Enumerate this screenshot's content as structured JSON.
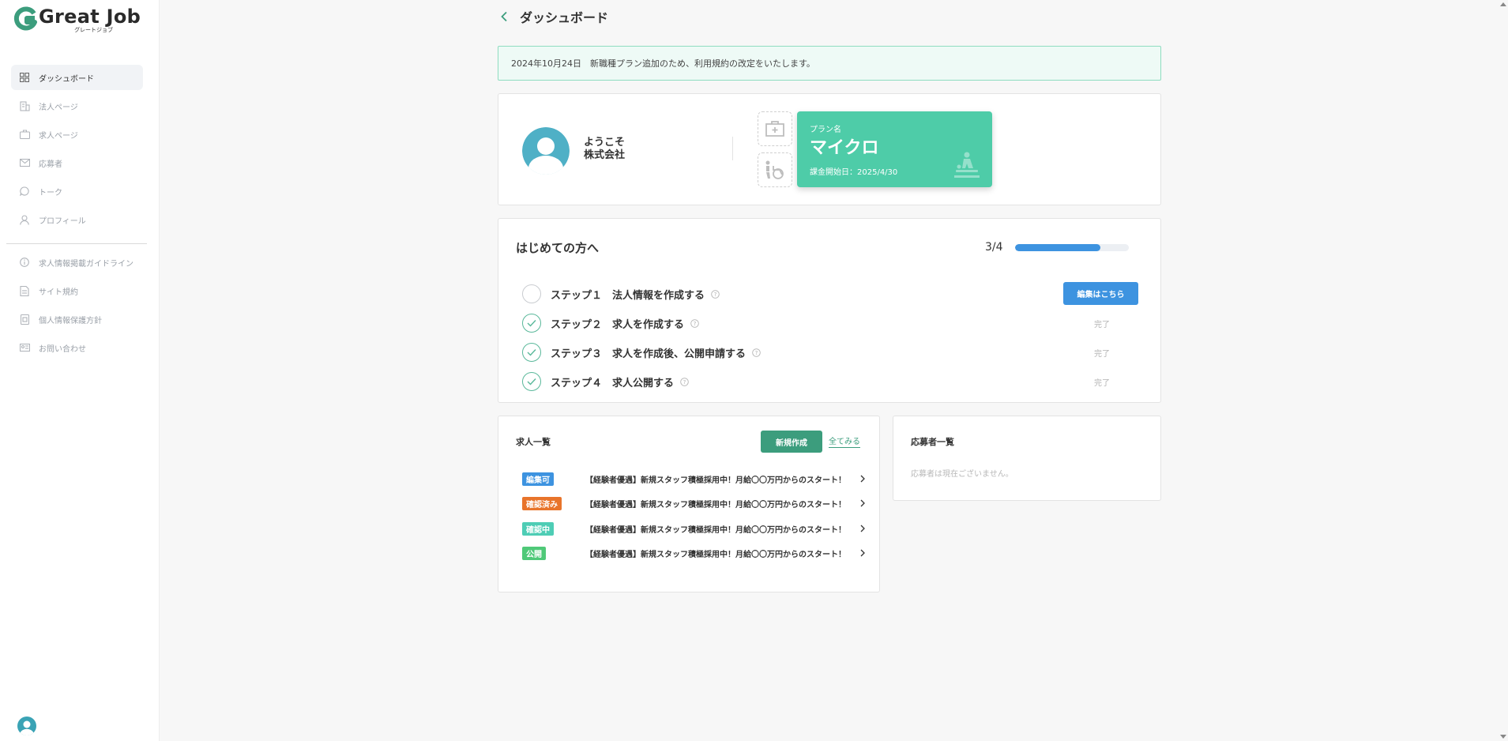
{
  "app": {
    "logo_title": "Great Job",
    "logo_sub": "グレートジョブ"
  },
  "sidebar": {
    "items": [
      {
        "label": "ダッシュボード",
        "icon": "grid-icon",
        "active": true
      },
      {
        "label": "法人ページ",
        "icon": "building-icon",
        "active": false
      },
      {
        "label": "求人ページ",
        "icon": "briefcase-icon",
        "active": false
      },
      {
        "label": "応募者",
        "icon": "mail-icon",
        "active": false
      },
      {
        "label": "トーク",
        "icon": "chat-icon",
        "active": false
      },
      {
        "label": "プロフィール",
        "icon": "user-icon",
        "active": false
      }
    ],
    "links": [
      {
        "label": "求人情報掲載ガイドライン",
        "icon": "info-icon"
      },
      {
        "label": "サイト規約",
        "icon": "document-icon"
      },
      {
        "label": "個人情報保護方針",
        "icon": "shield-document-icon"
      },
      {
        "label": "お問い合わせ",
        "icon": "contact-card-icon"
      }
    ]
  },
  "header": {
    "title": "ダッシュボード"
  },
  "notice": {
    "text": "2024年10月24日　新職種プラン追加のため、利用規約の改定をいたします。"
  },
  "profile": {
    "welcome": "ようこそ",
    "company": "株式会社",
    "plan_label": "プラン名",
    "plan_name": "マイクロ",
    "plan_start": "課金開始日：2025/4/30"
  },
  "steps": {
    "title": "はじめての方へ",
    "progress_text": "3/4",
    "progress_fraction": 0.75,
    "edit_button": "編集はこちら",
    "items": [
      {
        "text": "ステップ１　法人情報を作成する",
        "done": false,
        "status": ""
      },
      {
        "text": "ステップ２　求人を作成する",
        "done": true,
        "status": "完了"
      },
      {
        "text": "ステップ３　求人を作成後、公開申請する",
        "done": true,
        "status": "完了"
      },
      {
        "text": "ステップ４　求人公開する",
        "done": true,
        "status": "完了"
      }
    ]
  },
  "jobs": {
    "title": "求人一覧",
    "new_button": "新規作成",
    "see_all": "全てみる",
    "rows": [
      {
        "badge": "編集可",
        "badge_color": "#3d93e0",
        "title": "【経験者優遇】新規スタッフ積極採用中！月給〇〇万円からのスタート！"
      },
      {
        "badge": "確認済み",
        "badge_color": "#e8742b",
        "title": "【経験者優遇】新規スタッフ積極採用中！月給〇〇万円からのスタート！"
      },
      {
        "badge": "確認中",
        "badge_color": "#4ecdb5",
        "title": "【経験者優遇】新規スタッフ積極採用中！月給〇〇万円からのスタート！"
      },
      {
        "badge": "公開",
        "badge_color": "#4fc978",
        "title": "【経験者優遇】新規スタッフ積極採用中！月給〇〇万円からのスタート！"
      }
    ]
  },
  "applicants": {
    "title": "応募者一覧",
    "empty": "応募者は現在ございません。"
  },
  "colors": {
    "accent_green": "#4ecca8",
    "button_green": "#3c9d7d",
    "accent_blue": "#3d93e0"
  }
}
